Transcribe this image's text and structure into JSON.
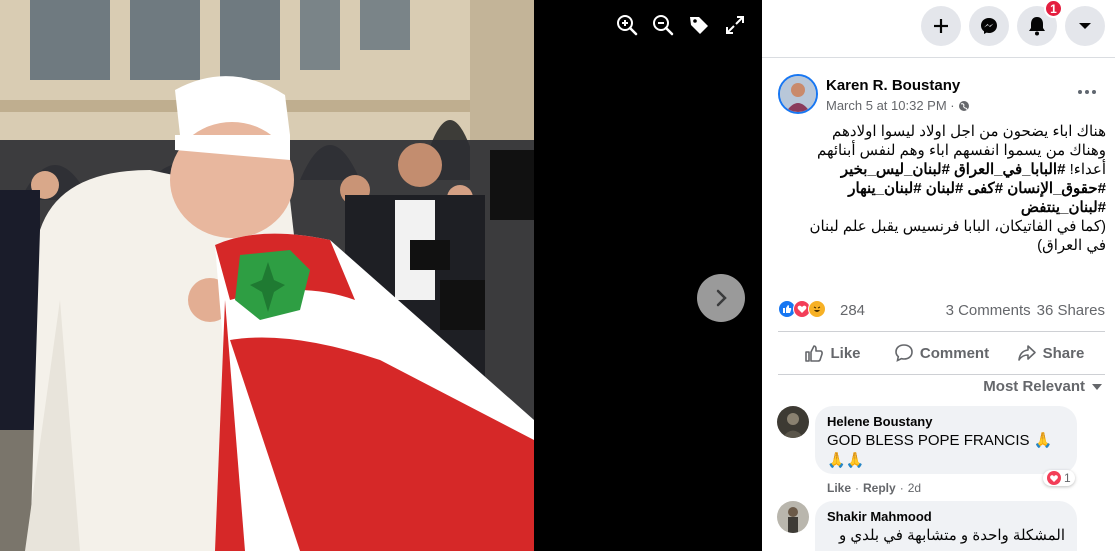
{
  "viewer": {
    "tools": [
      "zoom-in-icon",
      "zoom-out-icon",
      "tag-icon",
      "fullscreen-icon"
    ],
    "next": "chevron-right-icon"
  },
  "topbar": {
    "buttons": [
      "plus-icon",
      "messenger-icon",
      "bell-icon",
      "caret-down-icon"
    ],
    "notification_count": "1"
  },
  "post": {
    "author": "Karen R. Boustany",
    "date": "March 5 at 10:32 PM ·",
    "privacy_icon": "globe-icon",
    "text_line1": "هناك اباء يضحون من اجل اولاد ليسوا اولادهم",
    "text_line2": "وهناك من يسموا انفسهم اباء وهم لنفس أبنائهم",
    "text_line3_plain": "أعداء!",
    "text_line3_tags": "#البابا_في_العراق #لبنان_ليس_بخير",
    "text_line4": "#حقوق_الإنسان #كفى #لبنان #لبنان_ينهار",
    "text_line5": "#لبنان_ينتفض",
    "text_line6": "(كما في الفاتيكان، البابا فرنسيس يقبل علم لبنان",
    "text_line7": "في العراق)"
  },
  "reactions": {
    "icons": [
      "like-reaction-icon",
      "love-reaction-icon",
      "haha-reaction-icon"
    ],
    "count": "284",
    "comments": "3 Comments",
    "shares": "36 Shares"
  },
  "actions": {
    "like": "Like",
    "comment": "Comment",
    "share": "Share"
  },
  "sort_label": "Most Relevant",
  "comments": [
    {
      "name": "Helene Boustany",
      "text": "GOD BLESS POPE FRANCIS 🙏🙏🙏",
      "like": "Like",
      "reply": "Reply",
      "time": "2d",
      "reaction_count": "1"
    },
    {
      "name": "Shakir Mahmood",
      "text": "المشكلة واحدة و متشابهة في بلدي و"
    }
  ],
  "colors": {
    "brand": "#1877f2",
    "badge": "#e41e3f",
    "flag_red": "#d62828",
    "flag_green": "#2e9e43"
  }
}
